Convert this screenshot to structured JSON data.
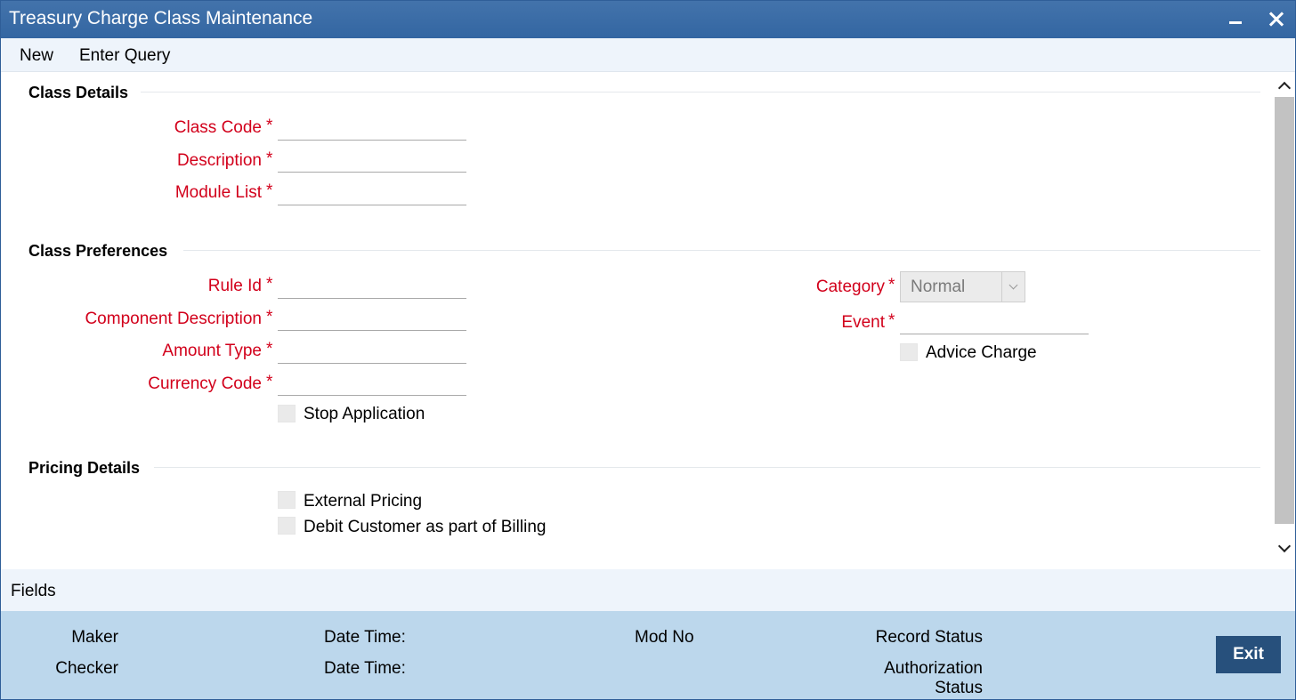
{
  "window": {
    "title": "Treasury Charge Class Maintenance"
  },
  "toolbar": {
    "new_label": "New",
    "enter_query_label": "Enter Query"
  },
  "class_details": {
    "section_title": "Class Details",
    "class_code_label": "Class Code",
    "class_code_value": "",
    "description_label": "Description",
    "description_value": "",
    "module_list_label": "Module List",
    "module_list_value": ""
  },
  "class_preferences": {
    "section_title": "Class Preferences",
    "rule_id_label": "Rule Id",
    "rule_id_value": "",
    "component_description_label": "Component Description",
    "component_description_value": "",
    "amount_type_label": "Amount Type",
    "amount_type_value": "",
    "currency_code_label": "Currency Code",
    "currency_code_value": "",
    "stop_application_label": "Stop Application",
    "category_label": "Category",
    "category_value": "Normal",
    "event_label": "Event",
    "event_value": "",
    "advice_charge_label": "Advice Charge"
  },
  "pricing_details": {
    "section_title": "Pricing Details",
    "external_pricing_label": "External Pricing",
    "debit_customer_label": "Debit Customer as part of Billing"
  },
  "required_marker": "*",
  "fields_bar": {
    "label": "Fields"
  },
  "footer": {
    "maker_label": "Maker",
    "checker_label": "Checker",
    "date_time_label_1": "Date Time:",
    "date_time_label_2": "Date Time:",
    "mod_no_label": "Mod No",
    "record_status_label": "Record Status",
    "authorization_label": "Authorization",
    "status_label": "Status",
    "exit_label": "Exit"
  },
  "colors": {
    "title_bar": "#3a6ea8",
    "required_label": "#d2001b",
    "footer_bg": "#bcd7ec",
    "exit_button": "#27507c"
  }
}
